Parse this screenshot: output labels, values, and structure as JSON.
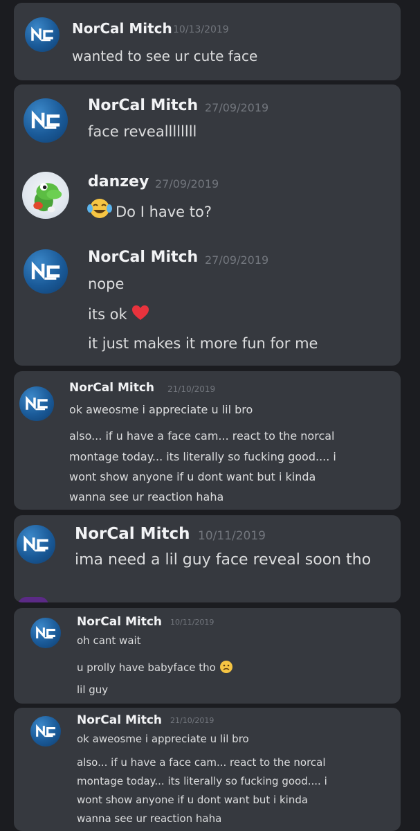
{
  "colors": {
    "background": "#1b1c20",
    "card": "#36393f",
    "username": "#f2f3f5",
    "message": "#dcddde",
    "timestamp": "#72767d",
    "avatar_brand": "#1f6bb0",
    "heart": "#e8333d"
  },
  "icons": {
    "avatar_logo": "norcal-logo-icon",
    "yoshi_avatar": "yoshi-avatar-icon",
    "laugh_emoji": "tears-of-joy-icon",
    "heart_emoji": "red-heart-icon",
    "worried_emoji": "worried-face-icon"
  },
  "cards": [
    {
      "messages": [
        {
          "author": "NorCal Mitch",
          "timestamp": "10/13/2019",
          "lines": [
            "wanted to see ur cute face"
          ]
        }
      ]
    },
    {
      "messages": [
        {
          "author": "NorCal Mitch",
          "timestamp": "27/09/2019",
          "lines": [
            "face reveallllllll"
          ]
        },
        {
          "author": "danzey",
          "timestamp": "27/09/2019",
          "lines": [
            "Do I have to?"
          ]
        },
        {
          "author": "NorCal Mitch",
          "timestamp": "27/09/2019",
          "lines": [
            "nope",
            "its ok",
            "it just makes it more fun for me"
          ]
        }
      ]
    },
    {
      "messages": [
        {
          "author": "NorCal Mitch",
          "timestamp": "21/10/2019",
          "lines": [
            "ok aweosme i appreciate u lil bro",
            "also... if u have a face cam... react to the norcal",
            "montage today... its literally so fucking good.... i",
            "wont show anyone if u dont want but i kinda",
            "wanna see ur reaction haha"
          ]
        }
      ]
    },
    {
      "messages": [
        {
          "author": "NorCal Mitch",
          "timestamp": "10/11/2019",
          "lines": [
            "ima need a lil guy face reveal soon tho"
          ]
        }
      ]
    },
    {
      "messages": [
        {
          "author": "NorCal Mitch",
          "timestamp": "10/11/2019",
          "lines": [
            "oh cant wait",
            "u prolly have babyface tho",
            "lil guy"
          ]
        }
      ]
    },
    {
      "messages": [
        {
          "author": "NorCal Mitch",
          "timestamp": "21/10/2019",
          "lines": [
            "ok aweosme i appreciate u lil bro",
            "also... if u have a face cam... react to the norcal",
            "montage today... its literally so fucking good.... i",
            "wont show anyone if u dont want but i kinda",
            "wanna see ur reaction haha"
          ]
        }
      ]
    }
  ]
}
